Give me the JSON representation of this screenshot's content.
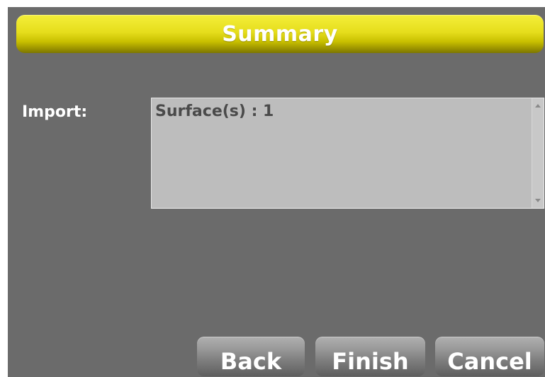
{
  "dialog": {
    "title": "Summary",
    "import_label": "Import:",
    "import_summary": "Surface(s) : 1"
  },
  "buttons": {
    "back": "Back",
    "finish": "Finish",
    "cancel": "Cancel"
  },
  "colors": {
    "background": "#6b6b6b",
    "title_bar": "#e6de1c",
    "text_area": "#bdbdbd",
    "button": "#8a8a8a"
  }
}
